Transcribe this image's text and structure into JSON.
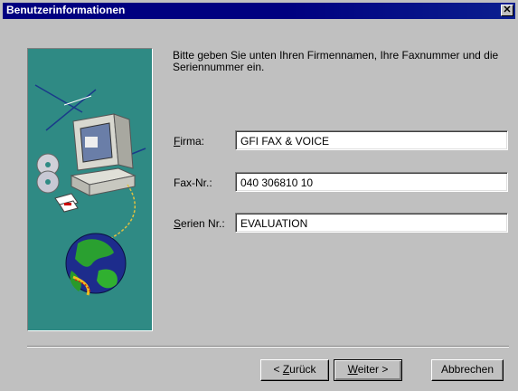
{
  "window": {
    "title": "Benutzerinformationen",
    "close_symbol": "✕"
  },
  "instructions": "Bitte geben Sie unten Ihren Firmennamen, Ihre Faxnummer und die Seriennummer ein.",
  "form": {
    "company": {
      "label_accel": "F",
      "label_rest": "irma:",
      "value": "GFI FAX & VOICE"
    },
    "fax": {
      "label": "Fax-Nr.:",
      "value": "040 306810 10"
    },
    "serial": {
      "label_accel": "S",
      "label_rest": "erien Nr.:",
      "value": "EVALUATION"
    }
  },
  "buttons": {
    "back": {
      "prefix": "< ",
      "accel": "Z",
      "rest": "urück"
    },
    "next": {
      "accel": "W",
      "rest": "eiter >"
    },
    "cancel": {
      "label": "Abbrechen"
    }
  },
  "colors": {
    "title_bar": "#000080",
    "dialog_bg": "#c0c0c0",
    "art_bg": "#2f8a84"
  }
}
